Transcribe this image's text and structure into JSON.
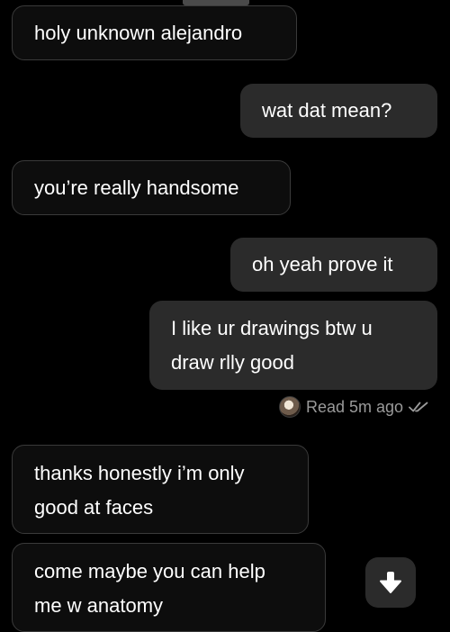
{
  "messages": {
    "m1": {
      "text": "holy unknown alejandro"
    },
    "m2": {
      "text": "wat dat mean?"
    },
    "m3": {
      "text": "you’re really handsome"
    },
    "m4": {
      "text": "oh yeah prove it"
    },
    "m5": {
      "line1": "I like ur drawings btw u",
      "line2": "draw rlly good"
    },
    "m6": {
      "line1": "thanks honestly i’m only",
      "line2": "good at faces"
    },
    "m7": {
      "line1": "come maybe you can help",
      "line2": "me w anatomy"
    }
  },
  "receipt": {
    "text": "Read 5m ago",
    "icon": "double-check-icon"
  },
  "controls": {
    "scroll_icon": "arrow-down-icon"
  },
  "colors": {
    "background": "#000000",
    "incoming_bg": "#0d0d0d",
    "incoming_border": "#3a3a3a",
    "outgoing_bg": "#2b2b2b",
    "text": "#ffffff",
    "meta": "#9a9a9a"
  }
}
